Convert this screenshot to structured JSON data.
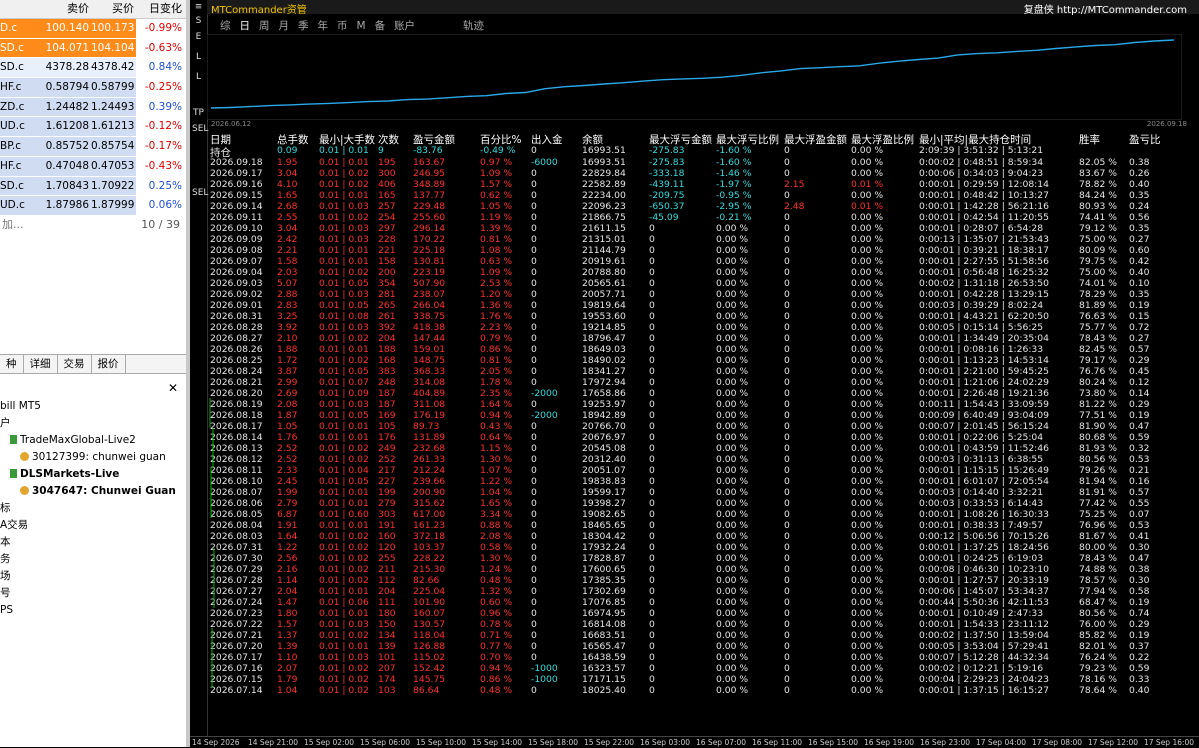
{
  "market_watch": {
    "headers": [
      "",
      "卖价",
      "买价",
      "日变化"
    ],
    "rows": [
      {
        "sym": "D.c",
        "bid": "100.140",
        "ask": "100.173",
        "chg": "-0.99%",
        "hl": "orange"
      },
      {
        "sym": "SD.c",
        "bid": "104.071",
        "ask": "104.104",
        "chg": "-0.63%",
        "hl": "orange"
      },
      {
        "sym": "SD.c",
        "bid": "4378.28",
        "ask": "4378.42",
        "chg": "0.84%",
        "hl": "light"
      },
      {
        "sym": "HF.c",
        "bid": "0.58794",
        "ask": "0.58799",
        "chg": "-0.25%",
        "hl": "blue"
      },
      {
        "sym": "ZD.c",
        "bid": "1.24482",
        "ask": "1.24493",
        "chg": "0.39%",
        "hl": "blue"
      },
      {
        "sym": "UD.c",
        "bid": "1.61208",
        "ask": "1.61213",
        "chg": "-0.12%",
        "hl": "blue"
      },
      {
        "sym": "BP.c",
        "bid": "0.85752",
        "ask": "0.85754",
        "chg": "-0.17%",
        "hl": "blue"
      },
      {
        "sym": "HF.c",
        "bid": "0.47048",
        "ask": "0.47053",
        "chg": "-0.43%",
        "hl": "blue"
      },
      {
        "sym": "SD.c",
        "bid": "1.70843",
        "ask": "1.70922",
        "chg": "0.25%",
        "hl": "blue"
      },
      {
        "sym": "UD.c",
        "bid": "1.87986",
        "ask": "1.87999",
        "chg": "0.06%",
        "hl": "blue"
      }
    ],
    "add_label": "加...",
    "count": "10 / 39"
  },
  "navigator": {
    "tabs": [
      "种",
      "详细",
      "交易",
      "报价"
    ],
    "tree": [
      {
        "text": "bill MT5",
        "indent": 0,
        "icon": "",
        "bold": false
      },
      {
        "text": "户",
        "indent": 0,
        "icon": "",
        "bold": false
      },
      {
        "text": "TradeMaxGlobal-Live2",
        "indent": 1,
        "icon": "acc",
        "bold": false
      },
      {
        "text": "30127399: chunwei guan",
        "indent": 2,
        "icon": "user",
        "bold": false
      },
      {
        "text": "DLSMarkets-Live",
        "indent": 1,
        "icon": "acc",
        "bold": true
      },
      {
        "text": "3047647: Chunwei Guan",
        "indent": 2,
        "icon": "user",
        "bold": true
      },
      {
        "text": "标",
        "indent": 0,
        "icon": "",
        "bold": false
      },
      {
        "text": "A交易",
        "indent": 0,
        "icon": "",
        "bold": false
      },
      {
        "text": "本",
        "indent": 0,
        "icon": "",
        "bold": false
      },
      {
        "text": "务",
        "indent": 0,
        "icon": "",
        "bold": false
      },
      {
        "text": "场",
        "indent": 0,
        "icon": "",
        "bold": false
      },
      {
        "text": "号",
        "indent": 0,
        "icon": "",
        "bold": false
      },
      {
        "text": "PS",
        "indent": 0,
        "icon": "",
        "bold": false
      }
    ]
  },
  "panel": {
    "brand": "MTCommander资管",
    "brand_right": "复盘侠 http://MTCommander.com",
    "periods": [
      "综",
      "日",
      "周",
      "月",
      "季",
      "年",
      "币",
      "M",
      "备",
      "账户"
    ],
    "active_period": "日",
    "equity_label": "轨迹",
    "side_labels": [
      "S",
      "E",
      "L",
      "L"
    ],
    "tool_labels": [
      "TP",
      "SEL",
      "SEL"
    ],
    "date_start": "2026.06.12",
    "date_end": "2026.09.18",
    "headers": [
      "日期",
      "总手数",
      "最小|大手数",
      "次数",
      "盈亏金额",
      "百分比%",
      "出入金",
      "余额",
      "最大浮亏金额",
      "最大浮亏比例",
      "最大浮盈金额",
      "最大浮盈比例",
      "最小|平均|最大持仓时间",
      "胜率",
      "盈亏比"
    ],
    "hold_row": {
      "date": "持仓",
      "lots": "0.09",
      "minmax": "0.01 | 0.01",
      "count": "9",
      "pnl": "-83.76",
      "pct": "-0.49 %",
      "io": "0",
      "bal": "16993.51",
      "mfa": "-275.83",
      "mfp": "-1.60 %",
      "mpa": "0",
      "mpp": "0.00 %",
      "time": "2:09:39 | 3:51:32 | 5:13:21",
      "win": "",
      "pf": ""
    },
    "rows": [
      [
        "2026.09.18",
        "1.95",
        "0.01 | 0.01",
        "195",
        "163.67",
        "0.97 %",
        "-6000",
        "16993.51",
        "-275.83",
        "-1.60 %",
        "0",
        "0.00 %",
        "0:00:02 | 0:48:51 | 8:59:34",
        "82.05 %",
        "0.38"
      ],
      [
        "2026.09.17",
        "3.04",
        "0.01 | 0.02",
        "300",
        "246.95",
        "1.09 %",
        "0",
        "22829.84",
        "-333.18",
        "-1.46 %",
        "0",
        "0.00 %",
        "0:00:06 | 0:34:03 | 9:04:23",
        "83.67 %",
        "0.26"
      ],
      [
        "2026.09.16",
        "4.10",
        "0.01 | 0.02",
        "406",
        "348.89",
        "1.57 %",
        "0",
        "22582.89",
        "-439.11",
        "-1.97 %",
        "2.15",
        "0.01 %",
        "0:00:01 | 0:29:59 | 12:08:14",
        "78.82 %",
        "0.40"
      ],
      [
        "2026.09.15",
        "1.65",
        "0.01 | 0.01",
        "165",
        "137.77",
        "0.62 %",
        "0",
        "22234.00",
        "-209.75",
        "-0.95 %",
        "0",
        "0.00 %",
        "0:00:01 | 0:48:42 | 10:13:27",
        "84.24 %",
        "0.35"
      ],
      [
        "2026.09.14",
        "2.68",
        "0.01 | 0.03",
        "257",
        "229.48",
        "1.05 %",
        "0",
        "22096.23",
        "-650.37",
        "-2.95 %",
        "2.48",
        "0.01 %",
        "0:00:01 | 1:42:28 | 56:21:16",
        "80.93 %",
        "0.24"
      ],
      [
        "2026.09.11",
        "2.55",
        "0.01 | 0.02",
        "254",
        "255.60",
        "1.19 %",
        "0",
        "21866.75",
        "-45.09",
        "-0.21 %",
        "0",
        "0.00 %",
        "0:00:01 | 0:42:54 | 11:20:55",
        "74.41 %",
        "0.56"
      ],
      [
        "2026.09.10",
        "3.04",
        "0.01 | 0.03",
        "297",
        "296.14",
        "1.39 %",
        "0",
        "21611.15",
        "0",
        "0.00 %",
        "0",
        "0.00 %",
        "0:00:01 | 0:28:07 | 6:54:28",
        "79.12 %",
        "0.35"
      ],
      [
        "2026.09.09",
        "2.42",
        "0.01 | 0.03",
        "228",
        "170.22",
        "0.81 %",
        "0",
        "21315.01",
        "0",
        "0.00 %",
        "0",
        "0.00 %",
        "0:00:13 | 1:35:07 | 21:53:43",
        "75.00 %",
        "0.27"
      ],
      [
        "2026.09.08",
        "2.21",
        "0.01 | 0.01",
        "221",
        "225.18",
        "1.08 %",
        "0",
        "21144.79",
        "0",
        "0.00 %",
        "0",
        "0.00 %",
        "0:00:01 | 0:39:21 | 18:38:17",
        "80.09 %",
        "0.60"
      ],
      [
        "2026.09.07",
        "1.58",
        "0.01 | 0.01",
        "158",
        "130.81",
        "0.63 %",
        "0",
        "20919.61",
        "0",
        "0.00 %",
        "0",
        "0.00 %",
        "0:00:01 | 2:27:55 | 51:58:56",
        "79.75 %",
        "0.42"
      ],
      [
        "2026.09.04",
        "2.03",
        "0.01 | 0.02",
        "200",
        "223.19",
        "1.09 %",
        "0",
        "20788.80",
        "0",
        "0.00 %",
        "0",
        "0.00 %",
        "0:00:01 | 0:56:48 | 16:25:32",
        "75.00 %",
        "0.40"
      ],
      [
        "2026.09.03",
        "5.07",
        "0.01 | 0.05",
        "354",
        "507.90",
        "2.53 %",
        "0",
        "20565.61",
        "0",
        "0.00 %",
        "0",
        "0.00 %",
        "0:00:02 | 1:31:18 | 26:53:50",
        "74.01 %",
        "0.10"
      ],
      [
        "2026.09.02",
        "2.88",
        "0.01 | 0.03",
        "281",
        "238.07",
        "1.20 %",
        "0",
        "20057.71",
        "0",
        "0.00 %",
        "0",
        "0.00 %",
        "0:00:01 | 0:42:28 | 13:29:15",
        "78.29 %",
        "0.35"
      ],
      [
        "2026.09.01",
        "2.83",
        "0.01 | 0.05",
        "265",
        "266.04",
        "1.36 %",
        "0",
        "19819.64",
        "0",
        "0.00 %",
        "0",
        "0.00 %",
        "0:00:03 | 0:39:29 | 8:02:24",
        "81.89 %",
        "0.19"
      ],
      [
        "2026.08.31",
        "3.25",
        "0.01 | 0.08",
        "261",
        "338.75",
        "1.76 %",
        "0",
        "19553.60",
        "0",
        "0.00 %",
        "0",
        "0.00 %",
        "0:00:01 | 4:43:21 | 62:20:50",
        "76.63 %",
        "0.15"
      ],
      [
        "2026.08.28",
        "3.92",
        "0.01 | 0.03",
        "392",
        "418.38",
        "2.23 %",
        "0",
        "19214.85",
        "0",
        "0.00 %",
        "0",
        "0.00 %",
        "0:00:05 | 0:15:14 | 5:56:25",
        "75.77 %",
        "0.72"
      ],
      [
        "2026.08.27",
        "2.10",
        "0.01 | 0.02",
        "204",
        "147.44",
        "0.79 %",
        "0",
        "18796.47",
        "0",
        "0.00 %",
        "0",
        "0.00 %",
        "0:00:01 | 1:34:49 | 20:35:04",
        "78.43 %",
        "0.27"
      ],
      [
        "2026.08.26",
        "1.88",
        "0.01 | 0.01",
        "188",
        "159.01",
        "0.86 %",
        "0",
        "18649.03",
        "0",
        "0.00 %",
        "0",
        "0.00 %",
        "0:00:01 | 0:08:16 | 1:26:33",
        "82.45 %",
        "0.57"
      ],
      [
        "2026.08.25",
        "1.72",
        "0.01 | 0.02",
        "168",
        "148.75",
        "0.81 %",
        "0",
        "18490.02",
        "0",
        "0.00 %",
        "0",
        "0.00 %",
        "0:00:01 | 1:13:23 | 14:53:14",
        "79.17 %",
        "0.29"
      ],
      [
        "2026.08.24",
        "3.87",
        "0.01 | 0.05",
        "383",
        "368.33",
        "2.05 %",
        "0",
        "18341.27",
        "0",
        "0.00 %",
        "0",
        "0.00 %",
        "0:00:01 | 2:21:00 | 59:45:25",
        "76.76 %",
        "0.45"
      ],
      [
        "2026.08.21",
        "2.99",
        "0.01 | 0.07",
        "248",
        "314.08",
        "1.78 %",
        "0",
        "17972.94",
        "0",
        "0.00 %",
        "0",
        "0.00 %",
        "0:00:01 | 1:21:06 | 24:02:29",
        "80.24 %",
        "0.12"
      ],
      [
        "2026.08.20",
        "2.69",
        "0.01 | 0.09",
        "187",
        "404.89",
        "2.35 %",
        "-2000",
        "17658.86",
        "0",
        "0.00 %",
        "0",
        "0.00 %",
        "0:00:01 | 2:26:48 | 19:21:36",
        "73.80 %",
        "0.14"
      ],
      [
        "2026.08.19",
        "2.08",
        "0.01 | 0.03",
        "187",
        "311.08",
        "1.64 %",
        "0",
        "19253.97",
        "0",
        "0.00 %",
        "0",
        "0.00 %",
        "0:00:11 | 1:54:43 | 33:09:59",
        "81.22 %",
        "0.29"
      ],
      [
        "2026.08.18",
        "1.87",
        "0.01 | 0.05",
        "169",
        "176.19",
        "0.94 %",
        "-2000",
        "18942.89",
        "0",
        "0.00 %",
        "0",
        "0.00 %",
        "0:00:09 | 6:40:49 | 93:04:09",
        "77.51 %",
        "0.19"
      ],
      [
        "2026.08.17",
        "1.05",
        "0.01 | 0.01",
        "105",
        "89.73",
        "0.43 %",
        "0",
        "20766.70",
        "0",
        "0.00 %",
        "0",
        "0.00 %",
        "0:00:07 | 2:01:45 | 56:15:24",
        "81.90 %",
        "0.47"
      ],
      [
        "2026.08.14",
        "1.76",
        "0.01 | 0.01",
        "176",
        "131.89",
        "0.64 %",
        "0",
        "20676.97",
        "0",
        "0.00 %",
        "0",
        "0.00 %",
        "0:00:01 | 0:22:06 | 5:25:04",
        "80.68 %",
        "0.59"
      ],
      [
        "2026.08.13",
        "2.52",
        "0.01 | 0.02",
        "249",
        "232.68",
        "1.15 %",
        "0",
        "20545.08",
        "0",
        "0.00 %",
        "0",
        "0.00 %",
        "0:00:01 | 0:43:59 | 11:52:46",
        "81.93 %",
        "0.32"
      ],
      [
        "2026.08.12",
        "2.52",
        "0.01 | 0.02",
        "252",
        "261.33",
        "1.30 %",
        "0",
        "20312.40",
        "0",
        "0.00 %",
        "0",
        "0.00 %",
        "0:00:03 | 0:31:13 | 6:38:55",
        "80.56 %",
        "0.53"
      ],
      [
        "2026.08.11",
        "2.33",
        "0.01 | 0.04",
        "217",
        "212.24",
        "1.07 %",
        "0",
        "20051.07",
        "0",
        "0.00 %",
        "0",
        "0.00 %",
        "0:00:01 | 1:15:15 | 15:26:49",
        "79.26 %",
        "0.21"
      ],
      [
        "2026.08.10",
        "2.45",
        "0.01 | 0.05",
        "227",
        "239.66",
        "1.22 %",
        "0",
        "19838.83",
        "0",
        "0.00 %",
        "0",
        "0.00 %",
        "0:00:01 | 6:01:07 | 72:05:54",
        "81.94 %",
        "0.16"
      ],
      [
        "2026.08.07",
        "1.99",
        "0.01 | 0.01",
        "199",
        "200.90",
        "1.04 %",
        "0",
        "19599.17",
        "0",
        "0.00 %",
        "0",
        "0.00 %",
        "0:00:03 | 0:14:40 | 3:32:21",
        "81.91 %",
        "0.57"
      ],
      [
        "2026.08.06",
        "2.79",
        "0.01 | 0.01",
        "279",
        "315.62",
        "1.65 %",
        "0",
        "19398.27",
        "0",
        "0.00 %",
        "0",
        "0.00 %",
        "0:00:03 | 0:33:53 | 6:14:43",
        "77.42 %",
        "0.55"
      ],
      [
        "2026.08.05",
        "6.87",
        "0.01 | 0.60",
        "303",
        "617.00",
        "3.34 %",
        "0",
        "19082.65",
        "0",
        "0.00 %",
        "0",
        "0.00 %",
        "0:00:01 | 1:08:26 | 16:30:33",
        "75.25 %",
        "0.07"
      ],
      [
        "2026.08.04",
        "1.91",
        "0.01 | 0.01",
        "191",
        "161.23",
        "0.88 %",
        "0",
        "18465.65",
        "0",
        "0.00 %",
        "0",
        "0.00 %",
        "0:00:01 | 0:38:33 | 7:49:57",
        "76.96 %",
        "0.53"
      ],
      [
        "2026.08.03",
        "1.64",
        "0.01 | 0.02",
        "160",
        "372.18",
        "2.08 %",
        "0",
        "18304.42",
        "0",
        "0.00 %",
        "0",
        "0.00 %",
        "0:00:12 | 5:06:56 | 70:15:26",
        "81.67 %",
        "0.41"
      ],
      [
        "2026.07.31",
        "1.22",
        "0.01 | 0.02",
        "120",
        "103.37",
        "0.58 %",
        "0",
        "17932.24",
        "0",
        "0.00 %",
        "0",
        "0.00 %",
        "0:00:01 | 1:37:25 | 18:24:56",
        "80.00 %",
        "0.30"
      ],
      [
        "2026.07.30",
        "2.56",
        "0.01 | 0.02",
        "255",
        "228.22",
        "1.30 %",
        "0",
        "17828.87",
        "0",
        "0.00 %",
        "0",
        "0.00 %",
        "0:00:01 | 0:24:25 | 6:19:03",
        "78.43 %",
        "0.47"
      ],
      [
        "2026.07.29",
        "2.16",
        "0.01 | 0.02",
        "211",
        "215.30",
        "1.24 %",
        "0",
        "17600.65",
        "0",
        "0.00 %",
        "0",
        "0.00 %",
        "0:00:08 | 0:46:30 | 10:23:10",
        "74.88 %",
        "0.38"
      ],
      [
        "2026.07.28",
        "1.14",
        "0.01 | 0.02",
        "112",
        "82.66",
        "0.48 %",
        "0",
        "17385.35",
        "0",
        "0.00 %",
        "0",
        "0.00 %",
        "0:00:01 | 1:27:57 | 20:33:19",
        "78.57 %",
        "0.30"
      ],
      [
        "2026.07.27",
        "2.04",
        "0.01 | 0.01",
        "204",
        "225.04",
        "1.32 %",
        "0",
        "17302.69",
        "0",
        "0.00 %",
        "0",
        "0.00 %",
        "0:00:06 | 1:45:07 | 53:34:37",
        "77.94 %",
        "0.58"
      ],
      [
        "2026.07.24",
        "1.47",
        "0.01 | 0.06",
        "111",
        "101.90",
        "0.60 %",
        "0",
        "17076.85",
        "0",
        "0.00 %",
        "0",
        "0.00 %",
        "0:00:44 | 5:50:36 | 42:11:53",
        "68.47 %",
        "0.19"
      ],
      [
        "2026.07.23",
        "1.80",
        "0.01 | 0.01",
        "180",
        "160.07",
        "0.96 %",
        "0",
        "16974.95",
        "0",
        "0.00 %",
        "0",
        "0.00 %",
        "0:00:01 | 0:10:49 | 2:47:33",
        "80.56 %",
        "0.74"
      ],
      [
        "2026.07.22",
        "1.57",
        "0.01 | 0.03",
        "150",
        "130.57",
        "0.78 %",
        "0",
        "16814.08",
        "0",
        "0.00 %",
        "0",
        "0.00 %",
        "0:00:01 | 1:54:33 | 23:11:12",
        "76.00 %",
        "0.29"
      ],
      [
        "2026.07.21",
        "1.37",
        "0.01 | 0.02",
        "134",
        "118.04",
        "0.71 %",
        "0",
        "16683.51",
        "0",
        "0.00 %",
        "0",
        "0.00 %",
        "0:00:02 | 1:37:50 | 13:59:04",
        "85.82 %",
        "0.19"
      ],
      [
        "2026.07.20",
        "1.39",
        "0.01 | 0.01",
        "139",
        "126.88",
        "0.77 %",
        "0",
        "16565.47",
        "0",
        "0.00 %",
        "0",
        "0.00 %",
        "0:00:05 | 3:53:04 | 57:29:41",
        "82.01 %",
        "0.37"
      ],
      [
        "2026.07.17",
        "1.10",
        "0.01 | 0.03",
        "101",
        "115.02",
        "0.70 %",
        "0",
        "16438.59",
        "0",
        "0.00 %",
        "0",
        "0.00 %",
        "0:00:07 | 5:12:28 | 44:32:34",
        "76.24 %",
        "0.22"
      ],
      [
        "2026.07.16",
        "2.07",
        "0.01 | 0.02",
        "207",
        "152.42",
        "0.94 %",
        "-1000",
        "16323.57",
        "0",
        "0.00 %",
        "0",
        "0.00 %",
        "0:00:02 | 0:12:21 | 5:19:16",
        "79.23 %",
        "0.59"
      ],
      [
        "2026.07.15",
        "1.79",
        "0.01 | 0.02",
        "174",
        "145.75",
        "0.86 %",
        "-1000",
        "17171.15",
        "0",
        "0.00 %",
        "0",
        "0.00 %",
        "0:00:04 | 2:29:23 | 24:04:23",
        "78.16 %",
        "0.33"
      ],
      [
        "2026.07.14",
        "1.04",
        "0.01 | 0.02",
        "103",
        "86.64",
        "0.48 %",
        "0",
        "18025.40",
        "0",
        "0.00 %",
        "0",
        "0.00 %",
        "0:00:01 | 1:37:15 | 16:15:27",
        "78.64 %",
        "0.40"
      ]
    ],
    "axis_labels": [
      "14 Sep 2026",
      "14 Sep 21:00",
      "15 Sep 02:00",
      "15 Sep 06:00",
      "15 Sep 10:00",
      "15 Sep 14:00",
      "15 Sep 18:00",
      "15 Sep 22:00",
      "16 Sep 03:00",
      "16 Sep 07:00",
      "16 Sep 11:00",
      "16 Sep 15:00",
      "16 Sep 19:00",
      "16 Sep 23:00",
      "17 Sep 04:00",
      "17 Sep 08:00",
      "17 Sep 12:00",
      "17 Sep 16:00"
    ]
  },
  "colors": {
    "positive": "#ff3030",
    "inflow": "#33dddd",
    "neutral": "#e6e6e6",
    "curve": "#2aa8e8",
    "orange_row": "#ff8c1a",
    "blue_row": "#cfdcf2"
  }
}
